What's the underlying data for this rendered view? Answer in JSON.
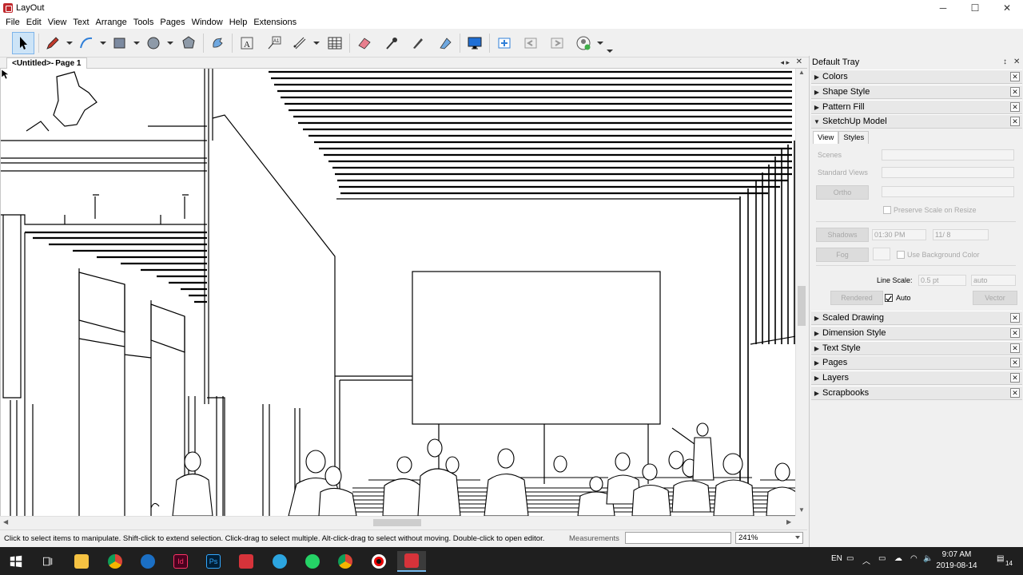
{
  "window": {
    "title": "LayOut",
    "min": "─",
    "max": "☐",
    "close": "✕"
  },
  "menu": [
    "File",
    "Edit",
    "View",
    "Text",
    "Arrange",
    "Tools",
    "Pages",
    "Window",
    "Help",
    "Extensions"
  ],
  "doc": {
    "tab_title": "<Untitled>",
    "separator": " - ",
    "page": "Page 1",
    "nav": "◂ ▸",
    "close": "✕"
  },
  "status": {
    "hint": "Click to select items to manipulate. Shift-click to extend selection. Click-drag to select multiple. Alt-click-drag to select without moving. Double-click to open editor.",
    "measurements_label": "Measurements",
    "measurements_value": "",
    "zoom": "241%"
  },
  "tray": {
    "title": "Default Tray",
    "pin": "↕",
    "close": "✕",
    "panels_top": [
      "Colors",
      "Shape Style",
      "Pattern Fill"
    ],
    "sketchup": {
      "title": "SketchUp Model",
      "tabs": [
        "View",
        "Styles"
      ],
      "scenes_label": "Scenes",
      "standard_views_label": "Standard Views",
      "ortho_label": "Ortho",
      "preserve_label": "Preserve Scale on Resize",
      "shadows_label": "Shadows",
      "time_value": "01:30 PM",
      "date_value": "11/ 8",
      "fog_label": "Fog",
      "use_bg_label": "Use Background Color",
      "line_scale_label": "Line Scale:",
      "line_scale_value": "0.5 pt",
      "auto_dd": "auto",
      "rendered_label": "Rendered",
      "auto_label": "Auto",
      "vector_label": "Vector"
    },
    "panels_bottom": [
      "Scaled Drawing",
      "Dimension Style",
      "Text Style",
      "Pages",
      "Layers",
      "Scrapbooks"
    ]
  },
  "taskbar": {
    "lang": "EN",
    "time": "9:07 AM",
    "date": "2019-08-14",
    "notif": "14",
    "apps": [
      "start",
      "task-view",
      "file-explorer",
      "chrome",
      "sketchup",
      "indesign",
      "photoshop",
      "layout-red",
      "telegram",
      "whatsapp",
      "chrome-2",
      "recorder",
      "layout-active"
    ],
    "colors": {
      "indesign": "#49021f",
      "photoshop": "#001e36",
      "accent": "#d6333a"
    }
  }
}
